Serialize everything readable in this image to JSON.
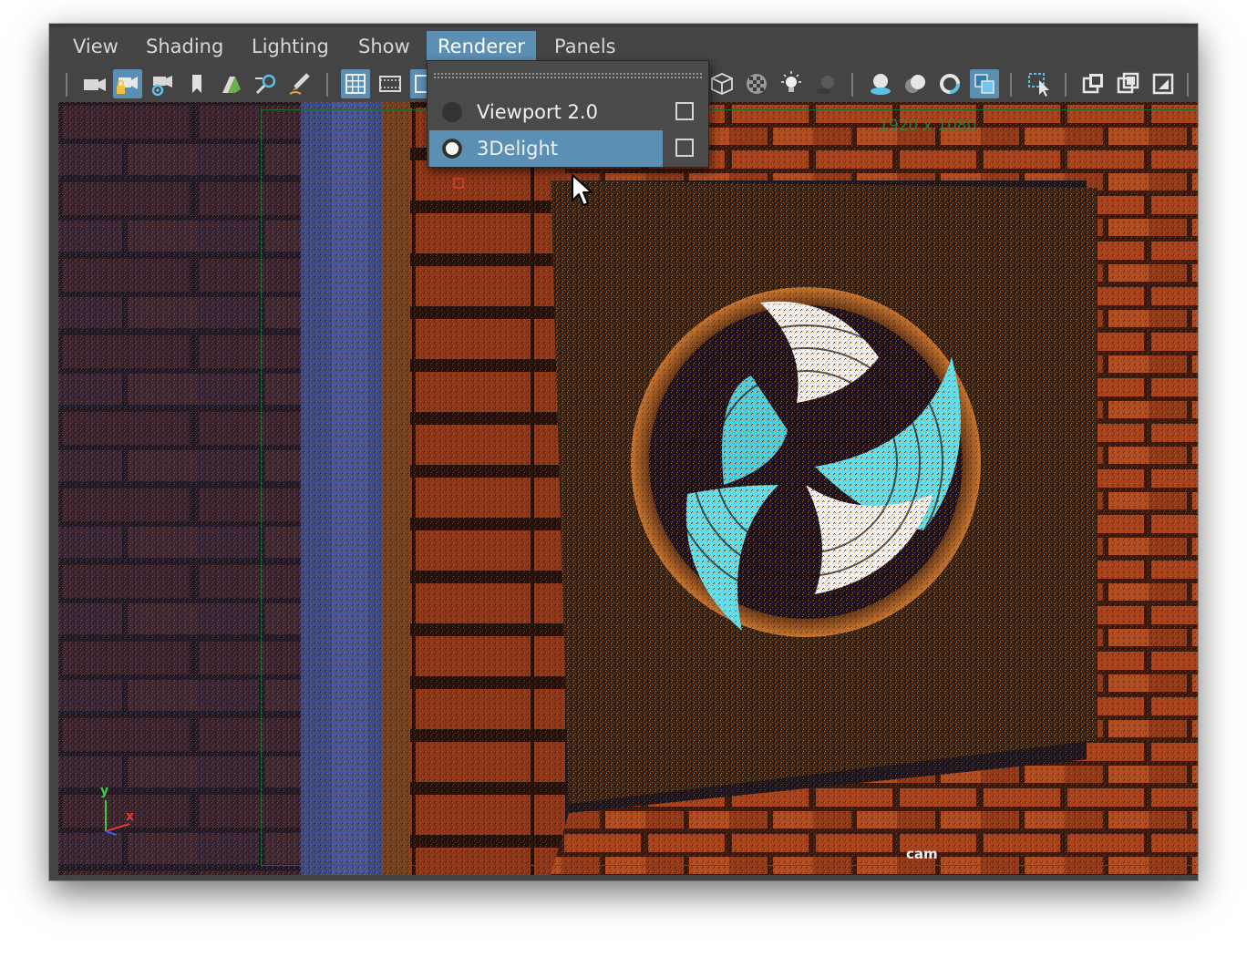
{
  "menubar": {
    "items": [
      "View",
      "Shading",
      "Lighting",
      "Show",
      "Renderer",
      "Panels"
    ],
    "active": "Renderer",
    "accent_color": "#5b8fb3"
  },
  "toolbar": {
    "icons": [
      "camera-icon",
      "lock-camera-icon",
      "camera-attributes-icon",
      "bookmark-icon",
      "image-plane-icon",
      "two-d-pan-zoom-icon",
      "grease-pencil-icon",
      "grid-icon",
      "film-gate-icon",
      "resolution-gate-icon",
      "wireframe-cube-icon",
      "checker-texture-icon",
      "light-bulb-icon",
      "shadow-icon",
      "screen-space-ao-icon",
      "motion-blur-icon",
      "anti-alias-icon",
      "isolate-select-icon",
      "select-camera-icon",
      "x-ray-icon",
      "x-ray-joints-icon",
      "hud-icon"
    ]
  },
  "renderer_menu": {
    "items": [
      {
        "label": "Viewport 2.0",
        "selected": false,
        "highlighted": false
      },
      {
        "label": "3Delight",
        "selected": true,
        "highlighted": true
      }
    ]
  },
  "viewport": {
    "resolution_label": "1920 x 1080",
    "camera_label": "cam",
    "axis_labels": {
      "y": "y",
      "x": "x"
    }
  }
}
